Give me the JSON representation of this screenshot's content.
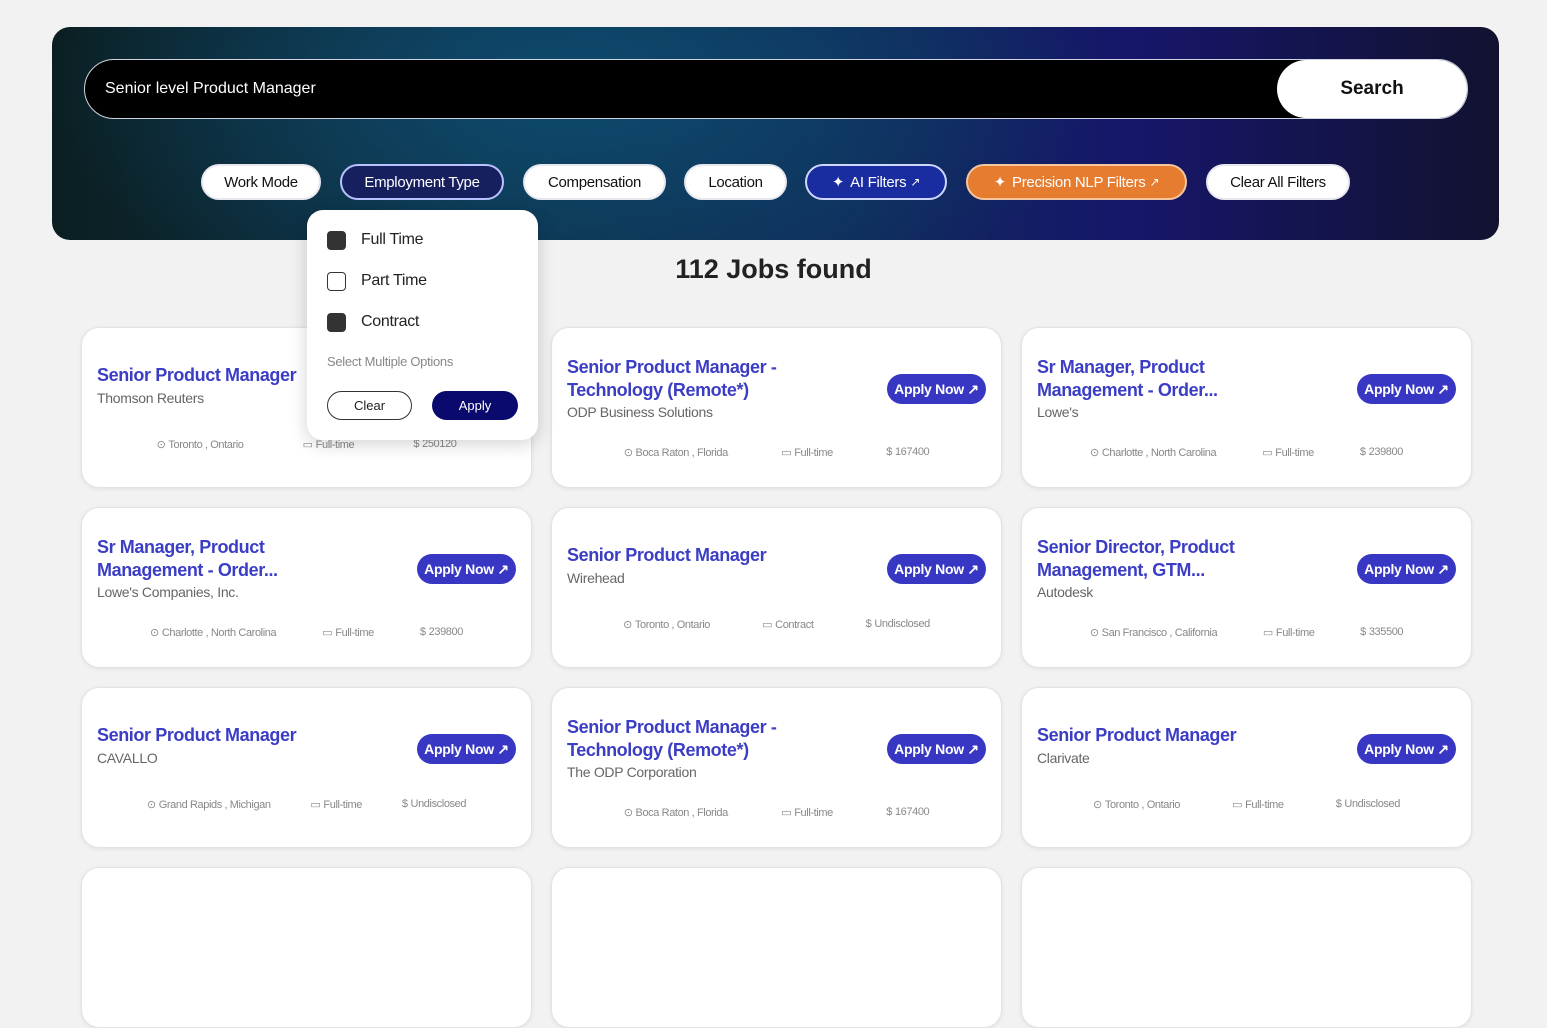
{
  "search": {
    "value": "Senior level Product Manager",
    "button_label": "Search"
  },
  "filters": {
    "work_mode": "Work Mode",
    "employment_type": "Employment Type",
    "compensation": "Compensation",
    "location": "Location",
    "ai_filters": "AI Filters",
    "nlp_filters": "Precision NLP Filters",
    "clear_all": "Clear All Filters"
  },
  "dropdown": {
    "options": [
      {
        "label": "Full Time",
        "checked": true
      },
      {
        "label": "Part Time",
        "checked": false
      },
      {
        "label": "Contract",
        "checked": true
      }
    ],
    "hint": "Select Multiple Options",
    "clear_label": "Clear",
    "apply_label": "Apply"
  },
  "jobs_count": "112 Jobs found",
  "apply_label": "Apply Now",
  "jobs": [
    {
      "title": "Senior Product Manager",
      "company": "Thomson Reuters",
      "location": "Toronto , Ontario",
      "type": "Full-time",
      "salary": "250120"
    },
    {
      "title": "Senior Product Manager - Technology (Remote*)",
      "company": "ODP Business Solutions",
      "location": "Boca Raton , Florida",
      "type": "Full-time",
      "salary": "167400"
    },
    {
      "title": "Sr Manager, Product Management - Order...",
      "company": "Lowe's",
      "location": "Charlotte , North Carolina",
      "type": "Full-time",
      "salary": "239800"
    },
    {
      "title": "Sr Manager, Product Management - Order...",
      "company": "Lowe's Companies, Inc.",
      "location": "Charlotte , North Carolina",
      "type": "Full-time",
      "salary": "239800"
    },
    {
      "title": "Senior Product Manager",
      "company": "Wirehead",
      "location": "Toronto , Ontario",
      "type": "Contract",
      "salary": "Undisclosed"
    },
    {
      "title": "Senior Director, Product Management, GTM...",
      "company": "Autodesk",
      "location": "San Francisco , California",
      "type": "Full-time",
      "salary": "335500"
    },
    {
      "title": "Senior Product Manager",
      "company": "CAVALLO",
      "location": "Grand Rapids , Michigan",
      "type": "Full-time",
      "salary": "Undisclosed"
    },
    {
      "title": "Senior Product Manager - Technology (Remote*)",
      "company": "The ODP Corporation",
      "location": "Boca Raton , Florida",
      "type": "Full-time",
      "salary": "167400"
    },
    {
      "title": "Senior Product Manager",
      "company": "Clarivate",
      "location": "Toronto , Ontario",
      "type": "Full-time",
      "salary": "Undisclosed"
    }
  ],
  "colors": {
    "accent": "#3737c4",
    "nlp": "#e57c2f",
    "apply_dark": "#0a0a6e"
  }
}
